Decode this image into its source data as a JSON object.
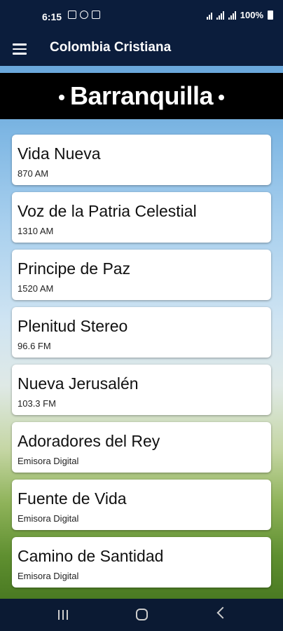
{
  "status_bar": {
    "time": "6:15",
    "battery": "100%"
  },
  "app_bar": {
    "title": "Colombia Cristiana"
  },
  "banner": {
    "city": "Barranquilla"
  },
  "stations": [
    {
      "name": "Vida Nueva",
      "frequency": "870 AM"
    },
    {
      "name": "Voz de la Patria Celestial",
      "frequency": "1310 AM"
    },
    {
      "name": "Principe de Paz",
      "frequency": "1520 AM"
    },
    {
      "name": "Plenitud Stereo",
      "frequency": "96.6 FM"
    },
    {
      "name": "Nueva Jerusalén",
      "frequency": "103.3 FM"
    },
    {
      "name": "Adoradores del Rey",
      "frequency": "Emisora Digital"
    },
    {
      "name": "Fuente de Vida",
      "frequency": "Emisora Digital"
    },
    {
      "name": "Camino de Santidad",
      "frequency": "Emisora Digital"
    }
  ],
  "colors": {
    "app_bar": "#0b1d3c",
    "banner": "#000000",
    "card": "#ffffff"
  },
  "icons": {
    "menu": "hamburger-menu-icon",
    "nav_recent": "recent-apps-icon",
    "nav_home": "home-icon",
    "nav_back": "back-icon"
  }
}
